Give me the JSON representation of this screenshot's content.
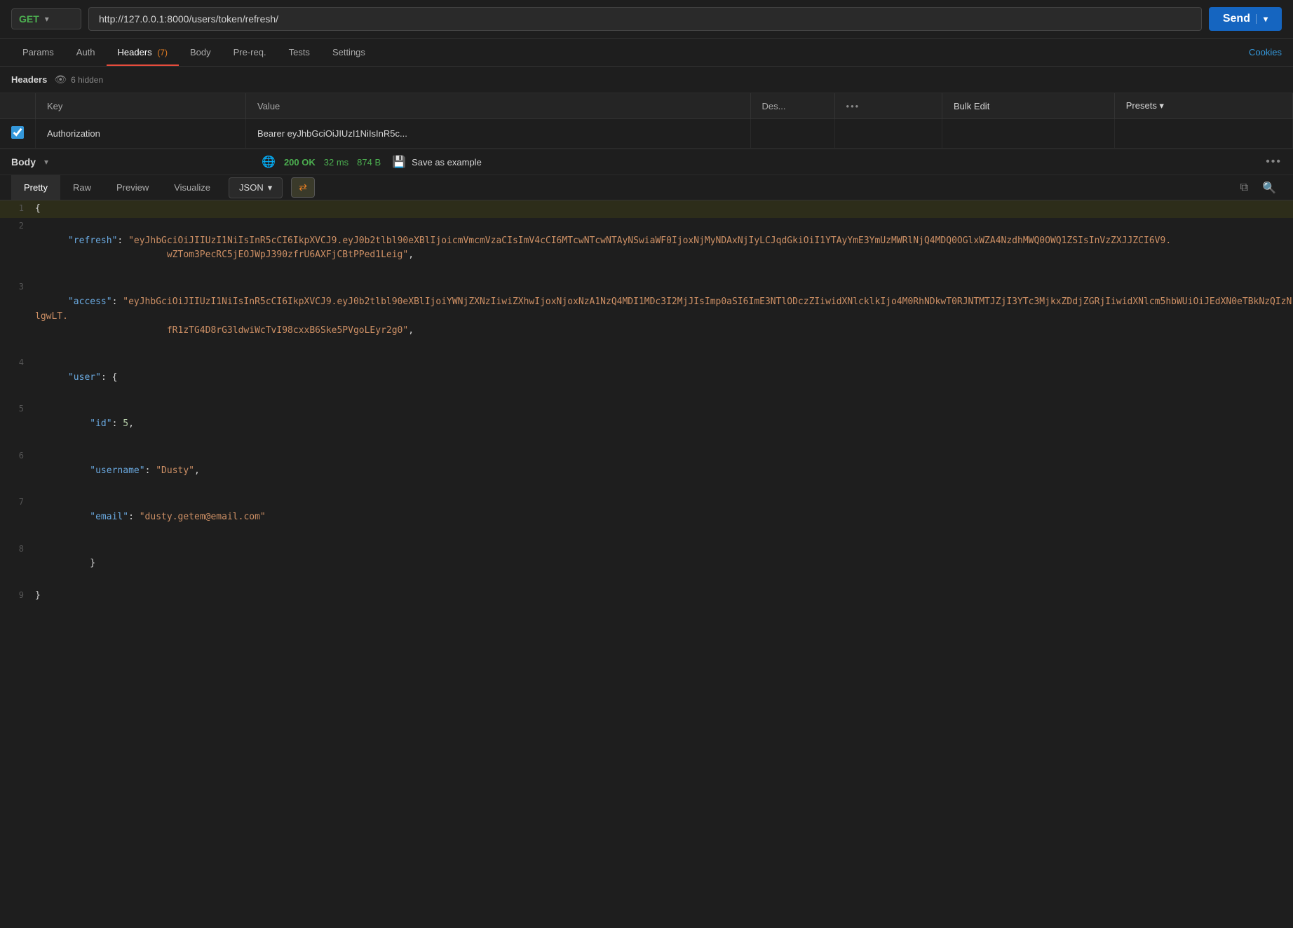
{
  "method": {
    "label": "GET",
    "badge": "GET"
  },
  "url": {
    "value": "http://127.0.0.1:8000/users/token/refresh/"
  },
  "send_button": {
    "label": "Send"
  },
  "tabs": {
    "items": [
      {
        "label": "Params",
        "active": false
      },
      {
        "label": "Auth",
        "active": false
      },
      {
        "label": "Headers",
        "active": true,
        "badge": "(7)"
      },
      {
        "label": "Body",
        "active": false
      },
      {
        "label": "Pre-req.",
        "active": false
      },
      {
        "label": "Tests",
        "active": false
      },
      {
        "label": "Settings",
        "active": false
      }
    ],
    "cookies_label": "Cookies"
  },
  "headers_section": {
    "title": "Headers",
    "hidden_label": "6 hidden"
  },
  "table": {
    "columns": [
      "",
      "Key",
      "Value",
      "Des...",
      "",
      "Bulk Edit",
      "Presets ▾"
    ],
    "rows": [
      {
        "checked": true,
        "key": "Authorization",
        "value": "Bearer eyJhbGciOiJIUzI1NiIsInR5c..."
      }
    ]
  },
  "response_bar": {
    "body_label": "Body",
    "status": "200 OK",
    "time": "32 ms",
    "size": "874 B",
    "save_example_label": "Save as example"
  },
  "response_tabs": {
    "items": [
      {
        "label": "Pretty",
        "active": true
      },
      {
        "label": "Raw",
        "active": false
      },
      {
        "label": "Preview",
        "active": false
      },
      {
        "label": "Visualize",
        "active": false
      }
    ],
    "format": "JSON"
  },
  "code": {
    "lines": [
      {
        "num": 1,
        "content": "{",
        "highlighted": true
      },
      {
        "num": 2,
        "content": "    \"refresh\": \"eyJhbGciOiJJIUzI1NiIsInR5cCI6IkpXVCJ9.eyJ0b2tlbl90eXBlIjoicmVmcmVzaCIsImV4cCI6MTcwNTcwNTAyNSwiaWF0IjoxNjMyNDAxNjIyLCJqdGkiOiI1YTAyYmE3YmUzMWRlNjQ4MDQ0OGlxYZA4NzdhMWQ0OWQ1ZSIsInVzZXJJZCI6V9.wZTom3PecRC5jEOJWpJ390zfrU6AXFjCBtPPed1Leig\""
      },
      {
        "num": 3,
        "content": "    \"access\": \"eyJhbGciOiJJIUzI1NiIsInR5cCI6IkpXVCJ9.eyJ0b2tlbl90eXBlIjoiYWNjZXNzIiwiZXhwIjoxNjoxNzA1NzQ4MDI1MDc3I2MjJIsImp0aSI6ImE3NTlODczZIiwidXNlcklkIjo4M0RhNDkwT0RJNTMTJZjI3YTc3MjkxZDdjZGRjIiwidXNlcm5hbWUiOiJEdXN0eTBkNzQIzNlgwLT.fR1zTG4D8rG3ldwiWcTvI98cxxB6Ske5PVgoLEyr2g0\""
      },
      {
        "num": 4,
        "content": "    \"user\": {"
      },
      {
        "num": 5,
        "content": "        \"id\": 5,"
      },
      {
        "num": 6,
        "content": "        \"username\": \"Dusty\","
      },
      {
        "num": 7,
        "content": "        \"email\": \"dusty.getem@email.com\""
      },
      {
        "num": 8,
        "content": "    }"
      },
      {
        "num": 9,
        "content": "}"
      }
    ]
  }
}
